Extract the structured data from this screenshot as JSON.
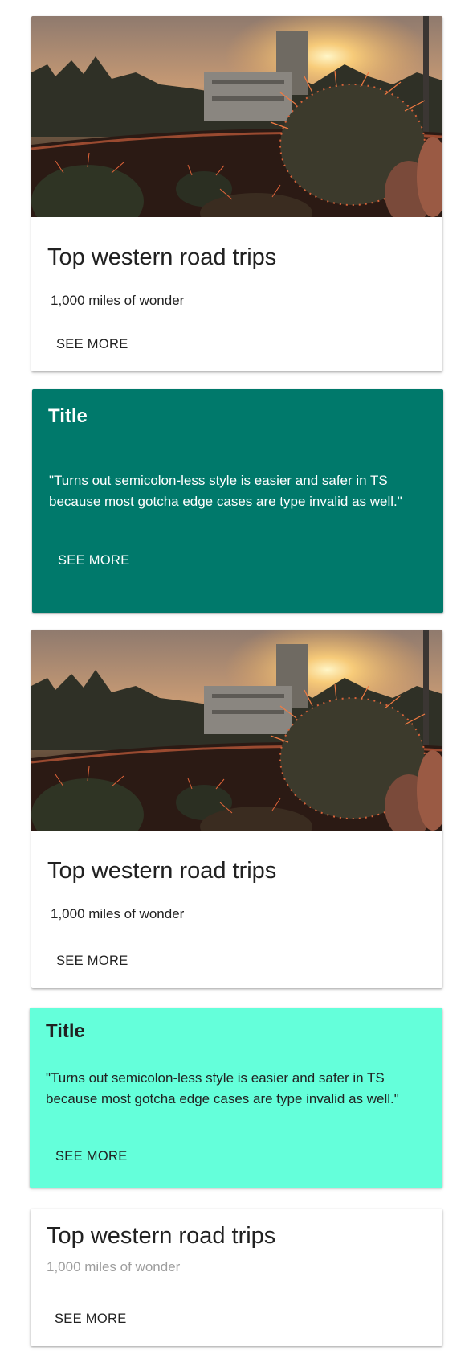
{
  "cards": [
    {
      "type": "media",
      "title": "Top western road trips",
      "subtitle": "1,000 miles of wonder",
      "action": "SEE MORE"
    },
    {
      "type": "colored",
      "title": "Title",
      "text": "\"Turns out semicolon-less style is easier and safer in TS because most gotcha edge cases are type invalid as well.\"",
      "action": "SEE MORE",
      "background": "#00796b",
      "text_color": "#ffffff"
    },
    {
      "type": "media",
      "title": "Top western road trips",
      "subtitle": "1,000 miles of wonder",
      "action": "SEE MORE"
    },
    {
      "type": "colored",
      "title": "Title",
      "text": "\"Turns out semicolon-less style is easier and safer in TS because most gotcha edge cases are type invalid as well.\"",
      "action": "SEE MORE",
      "background": "#64ffda",
      "text_color": "#212121"
    },
    {
      "type": "plain",
      "title": "Top western road trips",
      "subtitle": "1,000 miles of wonder",
      "action": "SEE MORE"
    }
  ],
  "colors": {
    "teal": "#00796b",
    "aqua": "#64ffda",
    "text_primary": "#212121",
    "text_secondary": "#9e9e9e"
  },
  "media_image": "sunset-cactus-photo"
}
